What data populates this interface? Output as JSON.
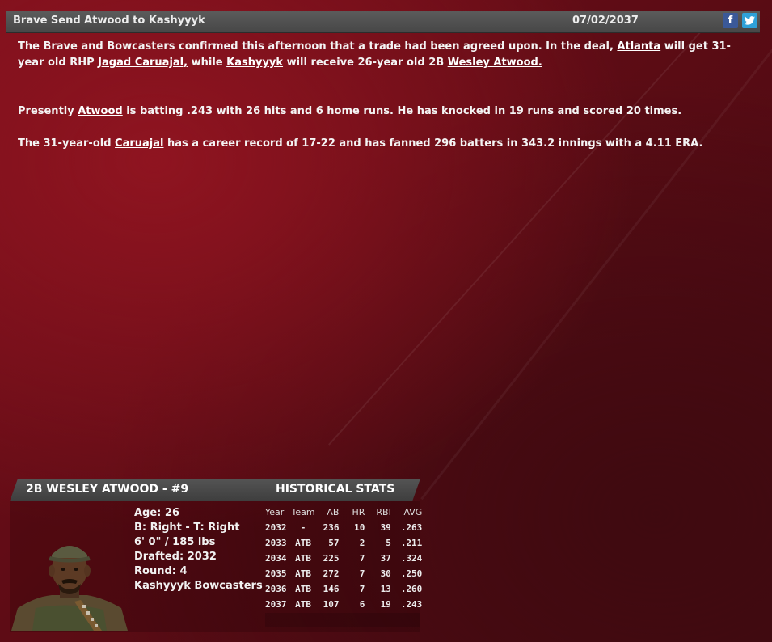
{
  "article": {
    "headline": "Brave Send Atwood to Kashyyyk",
    "date": "07/02/2037",
    "share": {
      "facebook_label": "f",
      "twitter_label": "t"
    },
    "p1": {
      "t1": "The Brave and Bowcasters confirmed this afternoon that a trade had been agreed upon. In the deal, ",
      "link_team1": "Atlanta",
      "t2": " will get 31-year old RHP ",
      "link_player1": "Jagad Caruajal,",
      "t3": " while ",
      "link_team2": "Kashyyyk",
      "t4": " will receive 26-year old 2B ",
      "link_player2": "Wesley Atwood."
    },
    "p2": {
      "t1": "Presently ",
      "link": "Atwood",
      "t2": " is batting .243 with 26 hits and 6 home runs. He has knocked in 19 runs and scored 20 times."
    },
    "p3": {
      "t1": "The 31-year-old ",
      "link": "Caruajal",
      "t2": " has a career record of 17-22 and has fanned 296 batters in 343.2 innings with a 4.11 ERA."
    }
  },
  "player_card": {
    "name": "2B WESLEY ATWOOD - #9",
    "stats_title": "HISTORICAL STATS",
    "bio": {
      "age": "Age: 26",
      "bats_throws": "B: Right - T: Right",
      "height_weight": "6' 0\" / 185 lbs",
      "drafted": "Drafted: 2032",
      "round": "Round: 4",
      "team": "Kashyyyk Bowcasters"
    },
    "stats": {
      "headers": [
        "Year",
        "Team",
        "AB",
        "HR",
        "RBI",
        "AVG"
      ],
      "rows": [
        [
          "2032",
          "-",
          "236",
          "10",
          "39",
          ".263"
        ],
        [
          "2033",
          "ATB",
          "57",
          "2",
          "5",
          ".211"
        ],
        [
          "2034",
          "ATB",
          "225",
          "7",
          "37",
          ".324"
        ],
        [
          "2035",
          "ATB",
          "272",
          "7",
          "30",
          ".250"
        ],
        [
          "2036",
          "ATB",
          "146",
          "7",
          "13",
          ".260"
        ],
        [
          "2037",
          "ATB",
          "107",
          "6",
          "19",
          ".243"
        ]
      ]
    }
  },
  "colors": {
    "background": "#6e0f1a",
    "title_bar": "#4f4f4f",
    "facebook": "#3b5998",
    "twitter": "#2ea1d8"
  }
}
